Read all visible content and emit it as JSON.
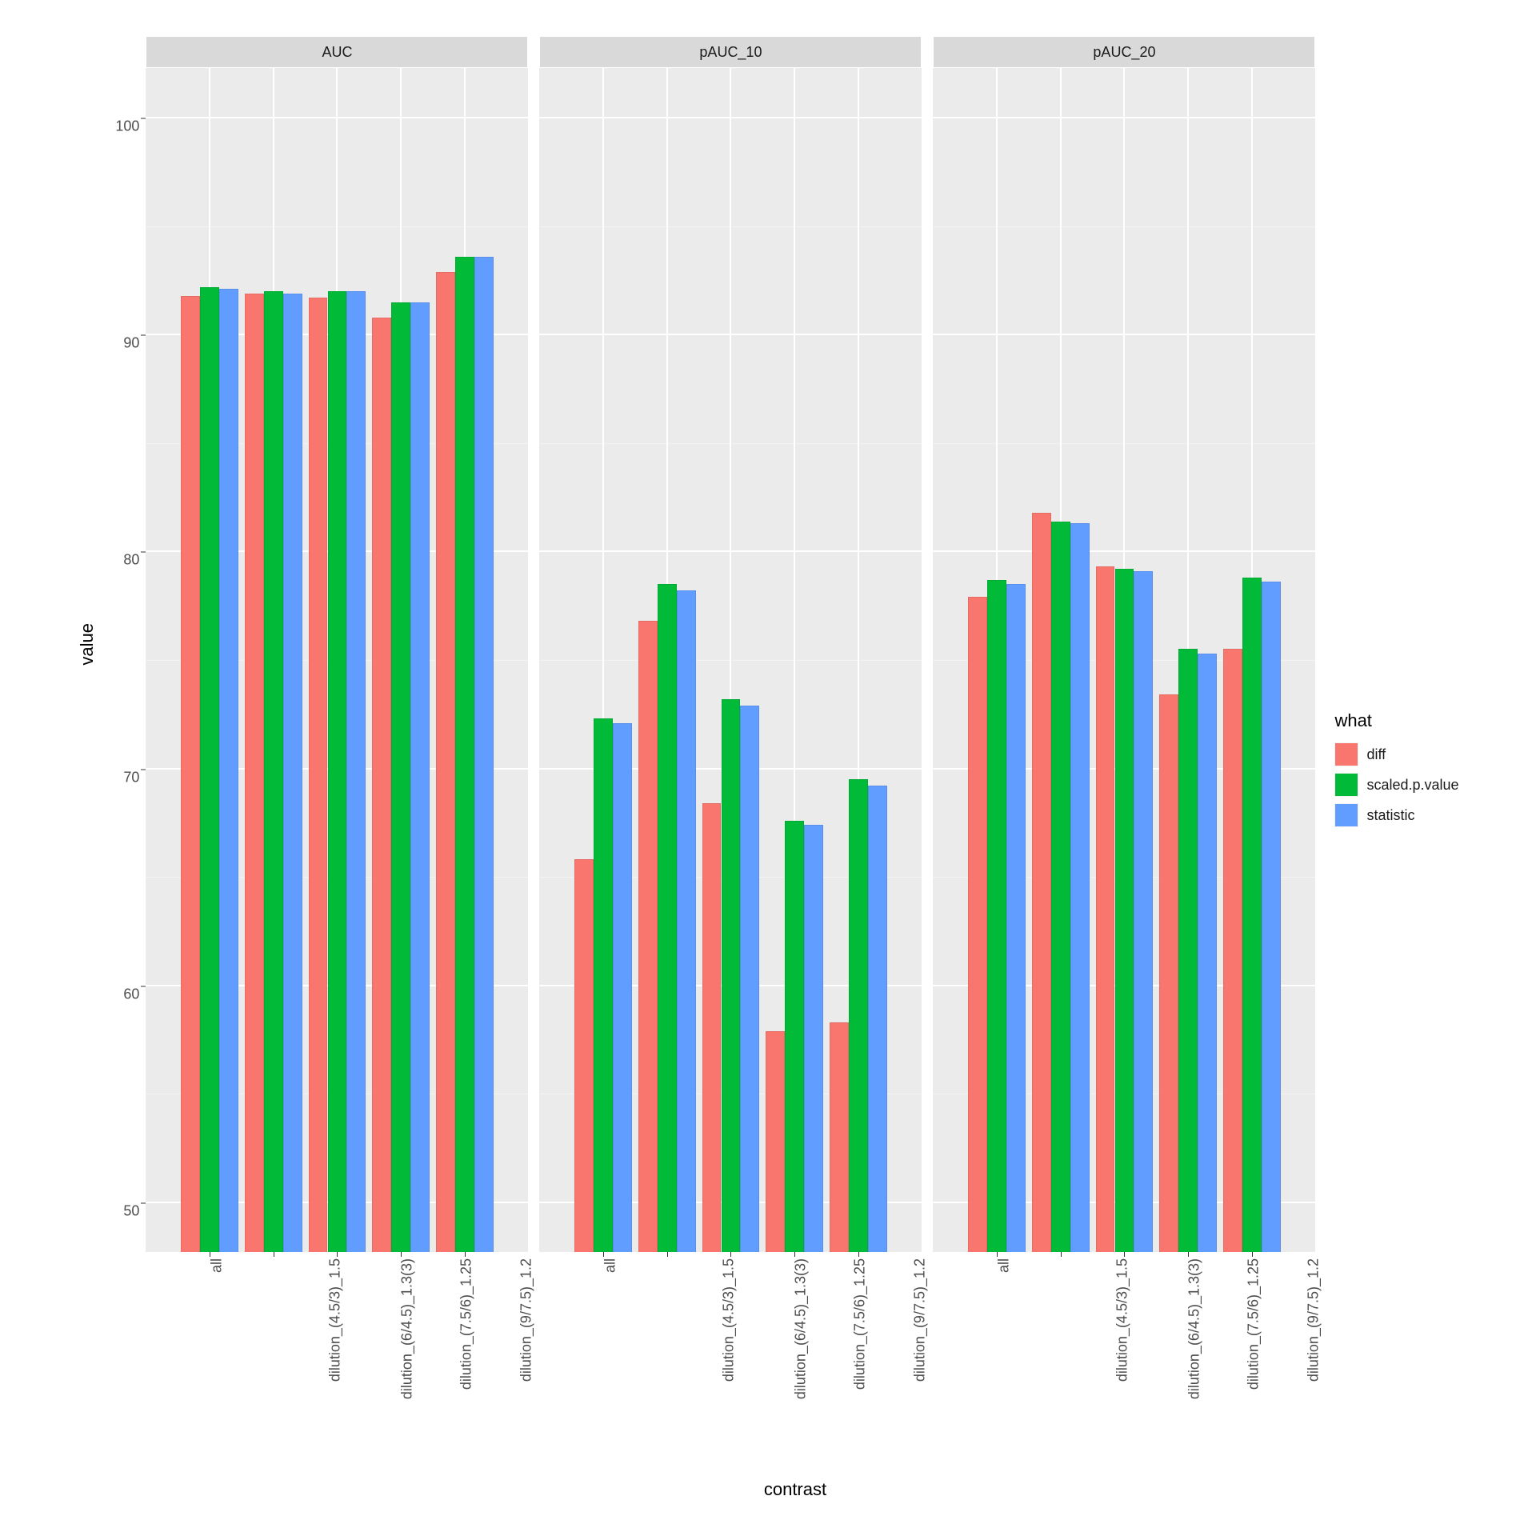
{
  "chart_data": {
    "type": "bar",
    "xlabel": "contrast",
    "ylabel": "value",
    "ylim": [
      47.7,
      102.3
    ],
    "y_ticks": [
      50,
      60,
      70,
      80,
      90,
      100
    ],
    "categories": [
      "all",
      "dilution_(4.5/3)_1.5",
      "dilution_(6/4.5)_1.3(3)",
      "dilution_(7.5/6)_1.25",
      "dilution_(9/7.5)_1.2"
    ],
    "legend_title": "what",
    "colors": {
      "diff": "#F8766D",
      "scaled.p.value": "#00BA38",
      "statistic": "#619CFF"
    },
    "facets": [
      {
        "name": "AUC",
        "series": [
          {
            "name": "diff",
            "values": [
              91.8,
              91.9,
              91.7,
              90.8,
              92.9
            ]
          },
          {
            "name": "scaled.p.value",
            "values": [
              92.2,
              92.0,
              92.0,
              91.5,
              93.6
            ]
          },
          {
            "name": "statistic",
            "values": [
              92.1,
              91.9,
              92.0,
              91.5,
              93.6
            ]
          }
        ]
      },
      {
        "name": "pAUC_10",
        "series": [
          {
            "name": "diff",
            "values": [
              65.8,
              76.8,
              68.4,
              57.9,
              58.3
            ]
          },
          {
            "name": "scaled.p.value",
            "values": [
              72.3,
              78.5,
              73.2,
              67.6,
              69.5
            ]
          },
          {
            "name": "statistic",
            "values": [
              72.1,
              78.2,
              72.9,
              67.4,
              69.2
            ]
          }
        ]
      },
      {
        "name": "pAUC_20",
        "series": [
          {
            "name": "diff",
            "values": [
              77.9,
              81.8,
              79.3,
              73.4,
              75.5
            ]
          },
          {
            "name": "scaled.p.value",
            "values": [
              78.7,
              81.4,
              79.2,
              75.5,
              78.8
            ]
          },
          {
            "name": "statistic",
            "values": [
              78.5,
              81.3,
              79.1,
              75.3,
              78.6
            ]
          }
        ]
      }
    ]
  }
}
